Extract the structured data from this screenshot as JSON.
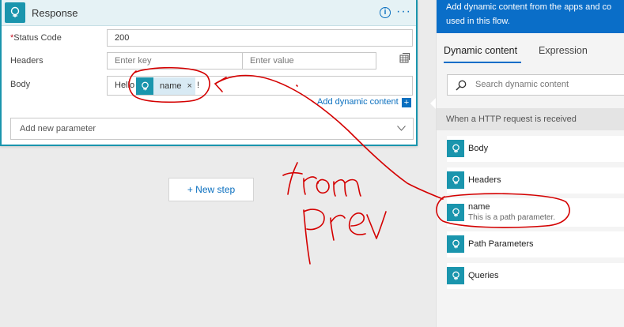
{
  "card": {
    "title": "Response",
    "info_icon": "info-icon",
    "more_icon": "more-icon",
    "status_code": {
      "required_mark": "*",
      "label": "Status Code",
      "value": "200"
    },
    "headers": {
      "label": "Headers",
      "key_placeholder": "Enter key",
      "value_placeholder": "Enter value"
    },
    "body": {
      "label": "Body",
      "text_before": "Hello",
      "text_after": "!",
      "token_label": "name",
      "token_remove": "×"
    },
    "add_dynamic_label": "Add dynamic content",
    "add_dynamic_plus": "+",
    "add_parameter_label": "Add new parameter"
  },
  "new_step_label": "+ New step",
  "panel": {
    "banner_line1": "Add dynamic content from the apps and co",
    "banner_line2": "used in this flow.",
    "tabs": [
      "Dynamic content",
      "Expression"
    ],
    "active_tab": "Dynamic content",
    "search_placeholder": "Search dynamic content",
    "section_title": "When a HTTP request is received",
    "items": [
      {
        "label": "Body",
        "description": ""
      },
      {
        "label": "Headers",
        "description": ""
      },
      {
        "label": "name",
        "description": "This is a path parameter."
      },
      {
        "label": "Path Parameters",
        "description": ""
      },
      {
        "label": "Queries",
        "description": ""
      }
    ]
  },
  "annotation": {
    "words": [
      "from",
      "prev"
    ],
    "color": "#d40000"
  },
  "colors": {
    "accent": "#0a6ec8",
    "connector": "#1a95ad",
    "token_bg": "#d8eaf4",
    "ink": "#d40000"
  }
}
